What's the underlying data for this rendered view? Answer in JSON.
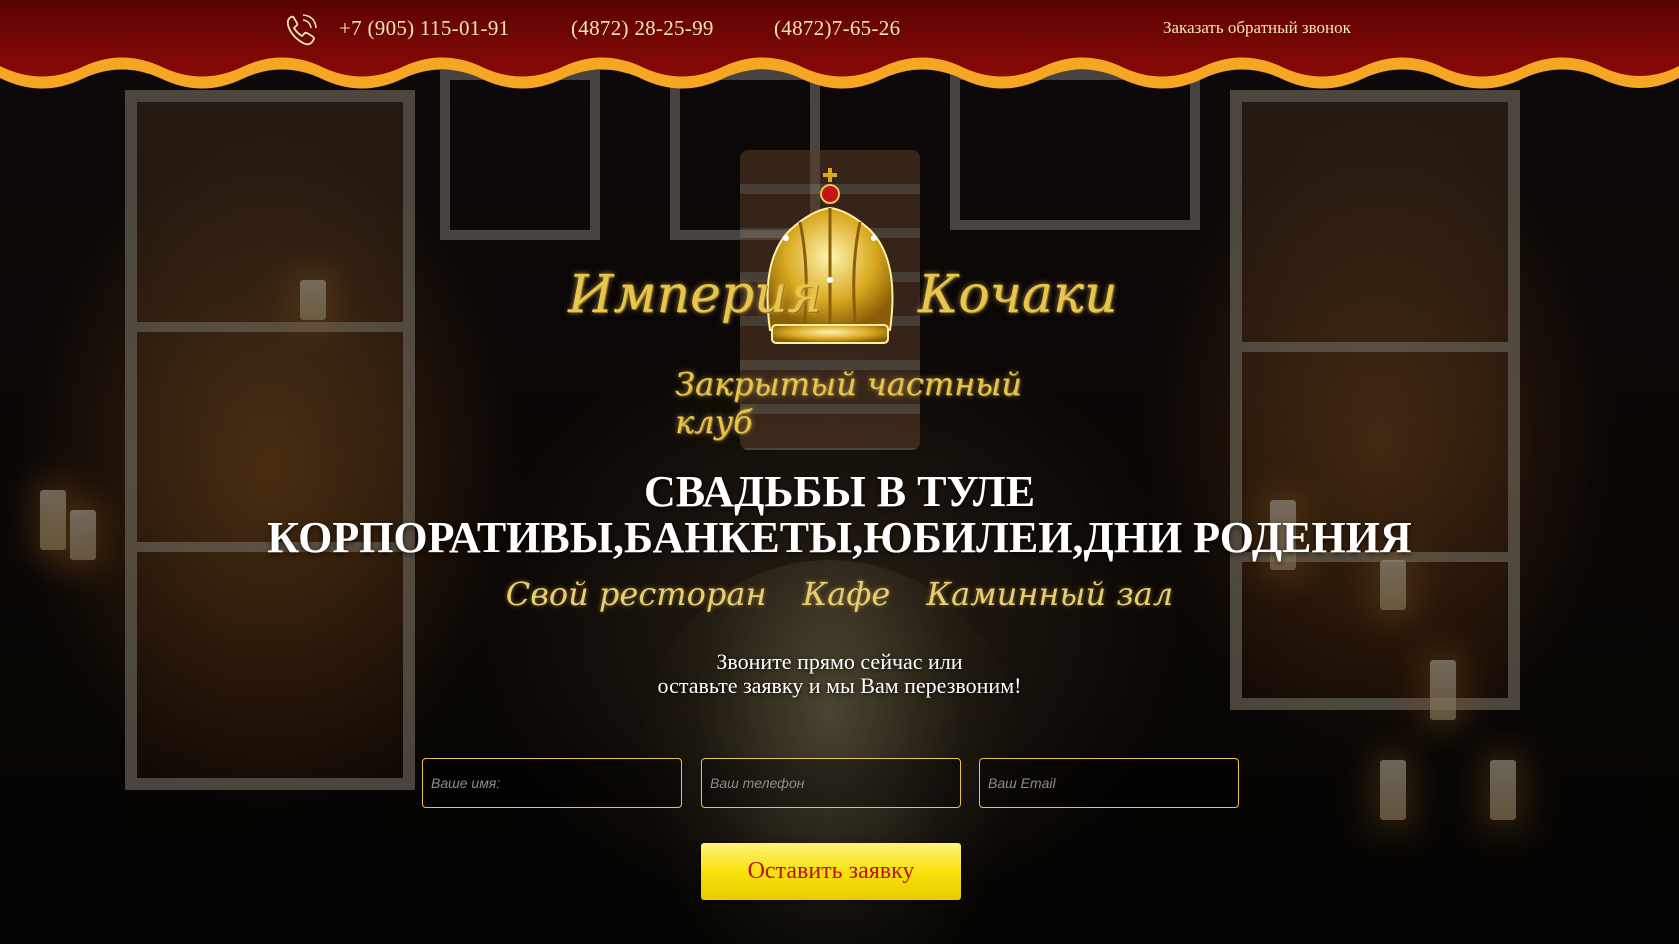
{
  "header": {
    "phones": [
      "+7 (905) 115-01-91",
      "(4872) 28-25-99",
      "(4872)7-65-26"
    ],
    "callback_label": "Заказать обратный звонок",
    "phone_icon": "phone-icon"
  },
  "logo": {
    "word1": "Империя",
    "word2": "Кочаки",
    "tagline": "Закрытый частный клуб",
    "emblem_icon": "crown-icon"
  },
  "hero": {
    "headline1": "СВАДЬБЫ В ТУЛЕ",
    "headline2": "КОРПОРАТИВЫ,БАНКЕТЫ,ЮБИЛЕИ,ДНИ РОДЕНИЯ",
    "venues": [
      "Свой ресторан",
      "Кафе",
      "Каминный зал"
    ],
    "cta_line1": "Звоните прямо сейчас или",
    "cta_line2": "оставьте заявку и мы Вам перезвоним!"
  },
  "form": {
    "name_placeholder": "Ваше имя:",
    "phone_placeholder": "Ваш телефон",
    "email_placeholder": "Ваш Email",
    "submit_label": "Оставить заявку"
  },
  "colors": {
    "curtain": "#7a0606",
    "curtain_trim": "#f5a623",
    "gold": "#e8c64a",
    "button": "#f7e20a",
    "button_text": "#b8141c"
  }
}
